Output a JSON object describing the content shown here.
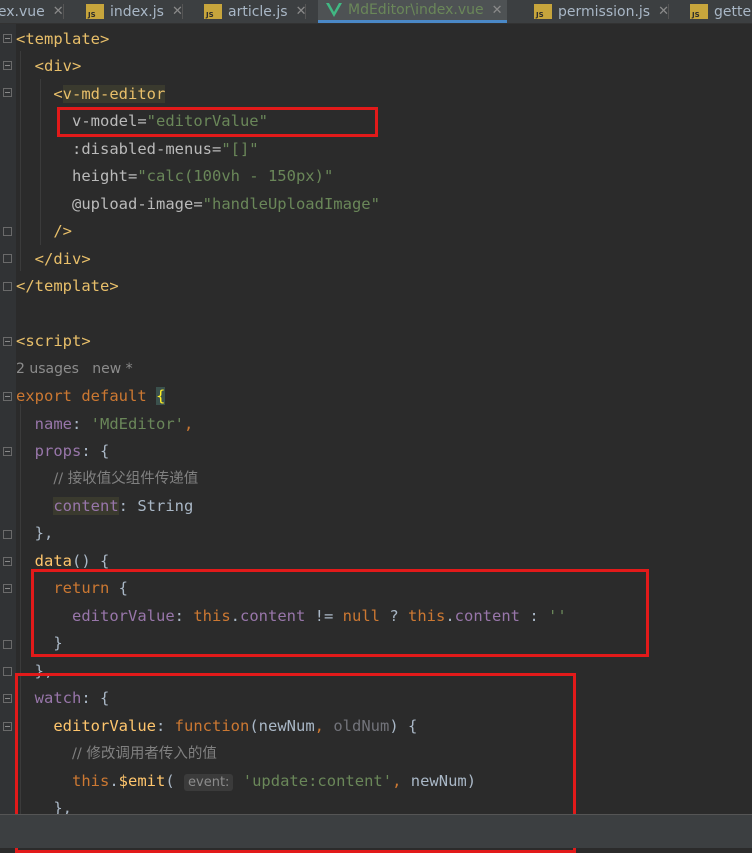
{
  "tabs": [
    {
      "label": "lex.vue",
      "icon": "vue-file-icon"
    },
    {
      "label": "index.js",
      "icon": "js-file-icon"
    },
    {
      "label": "article.js",
      "icon": "js-file-icon"
    },
    {
      "label": "MdEditor\\index.vue",
      "icon": "vue-file-icon",
      "active": true
    },
    {
      "label": "permission.js",
      "icon": "js-file-icon"
    },
    {
      "label": "gette",
      "icon": "js-file-icon"
    }
  ],
  "close_glyph": "✕",
  "code": {
    "l1": "<template>",
    "l2": "<div>",
    "l3_open": "<",
    "l3_tag": "v-md-editor",
    "l4_attr": "v-model=",
    "l4_val": "\"editorValue\"",
    "l5_attr": ":disabled-menus=",
    "l5_val": "\"[]\"",
    "l6_attr": "height=",
    "l6_val": "\"calc(100vh - 150px)\"",
    "l7_attr": "@upload-image=",
    "l7_val": "\"handleUploadImage\"",
    "l8": "/>",
    "l9": "</div>",
    "l10": "</template>",
    "l12": "<script>",
    "hint_usages": "2 usages",
    "hint_new": "new *",
    "l13_kw": "export default",
    "l13_brace": "{",
    "l14_key": "name",
    "l14_val": "'MdEditor'",
    "l15_key": "props",
    "l16_cmt": "// 接收值父组件传递值",
    "l17_key": "content",
    "l17_val": "String",
    "l18": "},",
    "l19_fn": "data",
    "l19_rest": "() {",
    "l20_kw": "return",
    "l20_rest": " {",
    "l21_key": "editorValue",
    "l21_this1": "this",
    "l21_prop1": "content",
    "l21_op": " != ",
    "l21_null": "null",
    "l21_q": " ? ",
    "l21_this2": "this",
    "l21_prop2": "content",
    "l21_colon": " : ",
    "l21_empty": "''",
    "l22": "}",
    "l23": "},",
    "l24_key": "watch",
    "l25_key": "editorValue",
    "l25_kw": "function",
    "l25_p1": "newNum",
    "l25_p2": "oldNum",
    "l26_cmt": "// 修改调用者传入的值",
    "l27_this": "this",
    "l27_emit": "$emit",
    "l27_hint": "event:",
    "l27_str": "'update:content'",
    "l27_arg": "newNum",
    "l28": "},"
  }
}
